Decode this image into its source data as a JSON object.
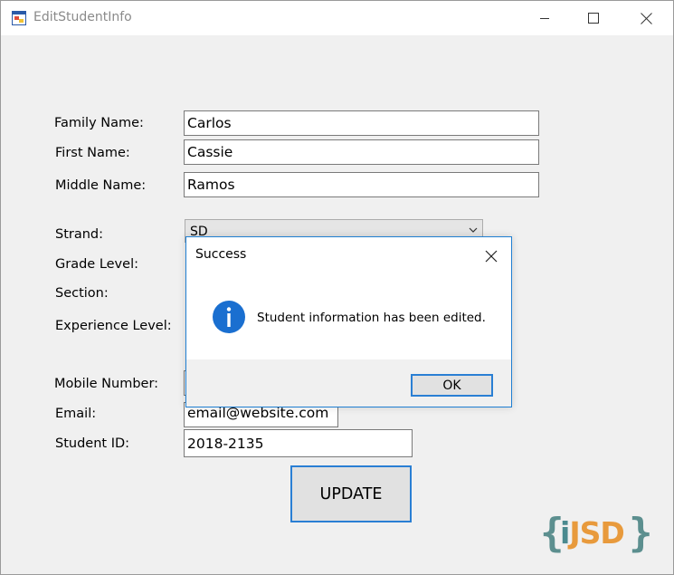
{
  "window": {
    "title": "EditStudentInfo",
    "minimize_icon": "minimize-icon",
    "maximize_icon": "maximize-icon",
    "close_icon": "close-icon"
  },
  "form": {
    "family_name_label": "Family Name:",
    "family_name_value": "Carlos",
    "first_name_label": "First Name:",
    "first_name_value": "Cassie",
    "middle_name_label": "Middle Name:",
    "middle_name_value": "Ramos",
    "strand_label": "Strand:",
    "strand_value": "SD",
    "grade_level_label": "Grade Level:",
    "section_label": "Section:",
    "experience_level_label": "Experience Level:",
    "mobile_number_label": "Mobile Number:",
    "email_label": "Email:",
    "email_value": "email@website.com",
    "student_id_label": "Student ID:",
    "student_id_value": "2018-2135",
    "update_button": "UPDATE"
  },
  "logo": {
    "left_brace": "{",
    "letter_i": "i",
    "letters_jsd": "JSD",
    "right_brace": "}",
    "colors": {
      "brace": "#5c8f8f",
      "i": "#4a8a8f",
      "jsd": "#e89a3c"
    }
  },
  "dialog": {
    "title": "Success",
    "icon": "info-icon",
    "message": "Student information has been edited.",
    "ok_button": "OK",
    "accent": "#1f7fd2"
  }
}
